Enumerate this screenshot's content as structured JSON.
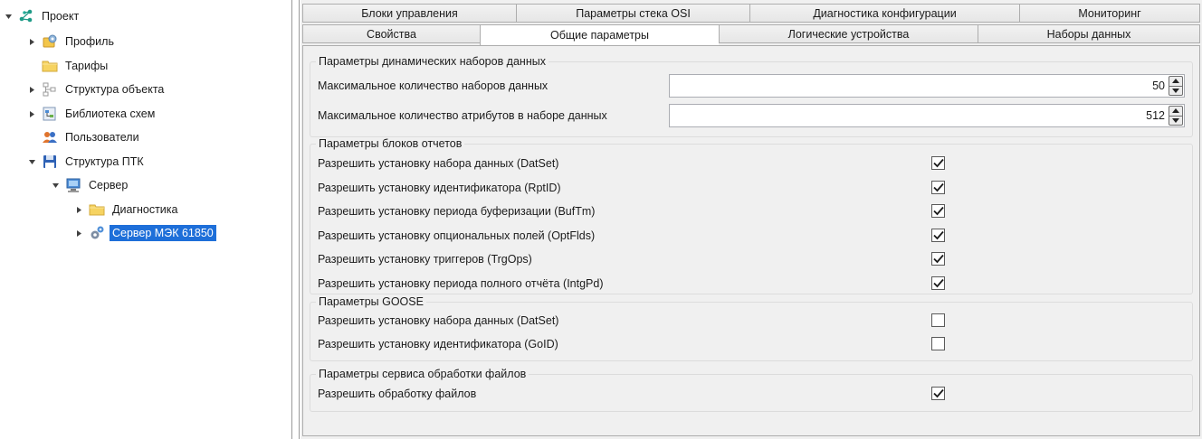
{
  "tree": {
    "nodes": [
      {
        "label": "Проект",
        "icon": "network-icon",
        "expanded": true
      },
      {
        "label": "Профиль",
        "icon": "profile-icon",
        "expanded": false
      },
      {
        "label": "Тарифы",
        "icon": "folder-icon"
      },
      {
        "label": "Структура объекта",
        "icon": "structure-icon",
        "expanded": false
      },
      {
        "label": "Библиотека схем",
        "icon": "schema-library-icon",
        "expanded": false
      },
      {
        "label": "Пользователи",
        "icon": "users-icon"
      },
      {
        "label": "Структура ПТК",
        "icon": "floppy-icon",
        "expanded": true
      },
      {
        "label": "Сервер",
        "icon": "computer-icon",
        "expanded": true
      },
      {
        "label": "Диагностика",
        "icon": "folder-icon",
        "expanded": false
      },
      {
        "label": "Сервер МЭК 61850",
        "icon": "gears-icon",
        "expanded": false,
        "selected": true
      }
    ]
  },
  "tabs": {
    "row1": [
      "Блоки управления",
      "Параметры стека OSI",
      "Диагностика конфигурации",
      "Мониторинг"
    ],
    "row2": [
      "Свойства",
      "Общие параметры",
      "Логические устройства",
      "Наборы данных"
    ],
    "active": "Общие параметры"
  },
  "groups": {
    "datasets": {
      "title": "Параметры динамических наборов данных",
      "max_datasets_label": "Максимальное количество наборов данных",
      "max_datasets_value": "50",
      "max_attrs_label": "Максимальное количество атрибутов в наборе данных",
      "max_attrs_value": "512"
    },
    "reports": {
      "title": "Параметры блоков отчетов",
      "items": [
        {
          "label": "Разрешить установку набора данных (DatSet)",
          "checked": true
        },
        {
          "label": "Разрешить установку идентификатора (RptID)",
          "checked": true
        },
        {
          "label": "Разрешить установку периода буферизации (BufTm)",
          "checked": true
        },
        {
          "label": "Разрешить установку опциональных полей (OptFlds)",
          "checked": true
        },
        {
          "label": "Разрешить установку триггеров (TrgOps)",
          "checked": true
        },
        {
          "label": "Разрешить установку периода полного отчёта (IntgPd)",
          "checked": true
        }
      ]
    },
    "goose": {
      "title": "Параметры GOOSE",
      "items": [
        {
          "label": "Разрешить установку набора данных (DatSet)",
          "checked": false
        },
        {
          "label": "Разрешить установку идентификатора (GoID)",
          "checked": false
        }
      ]
    },
    "files": {
      "title": "Параметры сервиса обработки файлов",
      "items": [
        {
          "label": "Разрешить обработку файлов",
          "checked": true
        }
      ]
    }
  },
  "colors": {
    "selection": "#1e6fd9",
    "panel_bg": "#f0f0f0",
    "border": "#adadad"
  }
}
